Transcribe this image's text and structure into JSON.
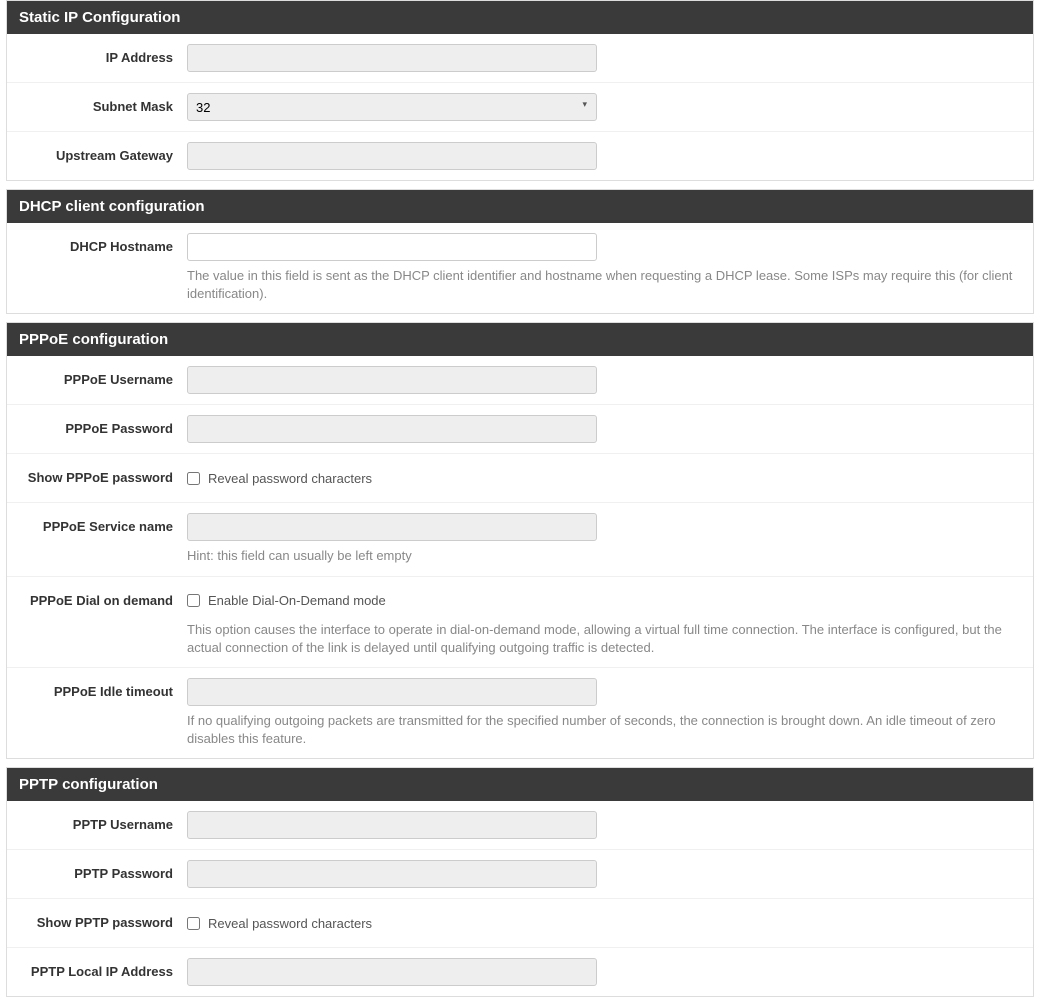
{
  "static_ip": {
    "header": "Static IP Configuration",
    "ip_address": {
      "label": "IP Address",
      "value": ""
    },
    "subnet_mask": {
      "label": "Subnet Mask",
      "value": "32"
    },
    "upstream_gateway": {
      "label": "Upstream Gateway",
      "value": ""
    }
  },
  "dhcp": {
    "header": "DHCP client configuration",
    "hostname": {
      "label": "DHCP Hostname",
      "value": "",
      "help": "The value in this field is sent as the DHCP client identifier and hostname when requesting a DHCP lease. Some ISPs may require this (for client identification)."
    }
  },
  "pppoe": {
    "header": "PPPoE configuration",
    "username": {
      "label": "PPPoE Username",
      "value": ""
    },
    "password": {
      "label": "PPPoE Password",
      "value": ""
    },
    "show_password": {
      "label": "Show PPPoE password",
      "checkbox_label": "Reveal password characters",
      "checked": false
    },
    "service_name": {
      "label": "PPPoE Service name",
      "value": "",
      "help": "Hint: this field can usually be left empty"
    },
    "dial_on_demand": {
      "label": "PPPoE Dial on demand",
      "checkbox_label": "Enable Dial-On-Demand mode",
      "checked": false,
      "help": "This option causes the interface to operate in dial-on-demand mode, allowing a virtual full time connection. The interface is configured, but the actual connection of the link is delayed until qualifying outgoing traffic is detected."
    },
    "idle_timeout": {
      "label": "PPPoE Idle timeout",
      "value": "",
      "help": "If no qualifying outgoing packets are transmitted for the specified number of seconds, the connection is brought down. An idle timeout of zero disables this feature."
    }
  },
  "pptp": {
    "header": "PPTP configuration",
    "username": {
      "label": "PPTP Username",
      "value": ""
    },
    "password": {
      "label": "PPTP Password",
      "value": ""
    },
    "show_password": {
      "label": "Show PPTP password",
      "checkbox_label": "Reveal password characters",
      "checked": false
    },
    "local_ip": {
      "label": "PPTP Local IP Address",
      "value": ""
    }
  }
}
